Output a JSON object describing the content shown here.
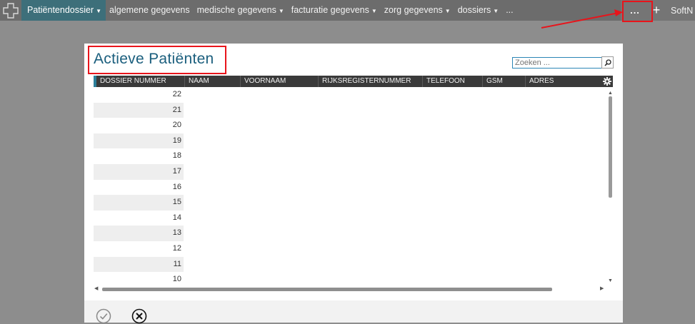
{
  "nav": {
    "active_item": "Patiëntendossier",
    "items": [
      {
        "label": "algemene gegevens",
        "dropdown": false
      },
      {
        "label": "medische gegevens",
        "dropdown": true
      },
      {
        "label": "facturatie gegevens",
        "dropdown": true
      },
      {
        "label": "zorg gegevens",
        "dropdown": true
      },
      {
        "label": "dossiers",
        "dropdown": true
      },
      {
        "label": "...",
        "dropdown": false
      }
    ],
    "more_label": "...",
    "add_label": "+",
    "brand": "SoftN"
  },
  "panel": {
    "title": "Actieve Patiënten",
    "search_placeholder": "Zoeken ...",
    "columns": [
      "DOSSIER NUMMER",
      "NAAM",
      "VOORNAAM",
      "RIJKSREGISTERNUMMER",
      "TELEFOON",
      "GSM",
      "ADRES"
    ],
    "rows": [
      "22",
      "21",
      "20",
      "19",
      "18",
      "17",
      "16",
      "15",
      "14",
      "13",
      "12",
      "11",
      "10"
    ]
  },
  "colors": {
    "accent": "#3d6f7a",
    "title": "#1a5e7d",
    "highlight": "#e8141b"
  }
}
